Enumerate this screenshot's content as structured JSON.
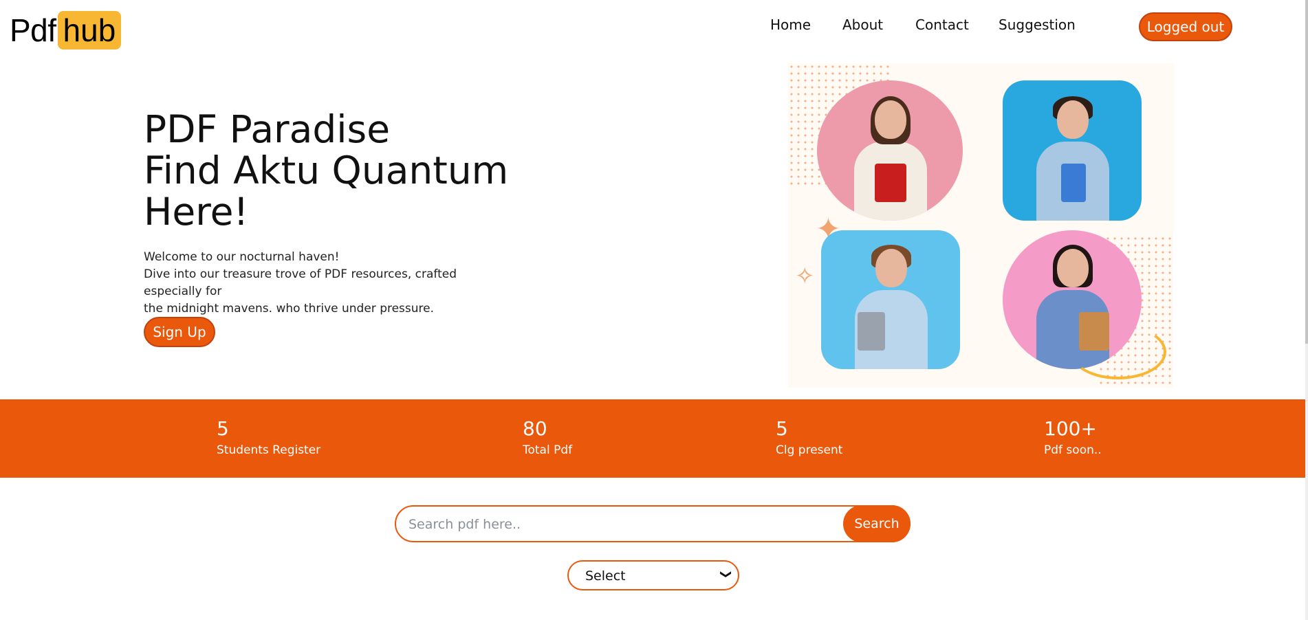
{
  "logo": {
    "part1": "Pdf",
    "part2": "hub",
    "accent": "#f7b733"
  },
  "nav": {
    "items": [
      "Home",
      "About",
      "Contact",
      "Suggestion"
    ],
    "logout_label": "Logged out"
  },
  "hero": {
    "title_lines": [
      "PDF Paradise",
      "Find Aktu Quantum",
      "Here!"
    ],
    "desc_lines": [
      "Welcome to our nocturnal haven!",
      "Dive into our treasure trove of PDF resources, crafted especially for",
      "the midnight mavens. who thrive under pressure."
    ],
    "signup_label": "Sign Up",
    "image_alt": "students-collage"
  },
  "stats": [
    {
      "value": "5",
      "label": "Students Register"
    },
    {
      "value": "80",
      "label": "Total Pdf"
    },
    {
      "value": "5",
      "label": "Clg present"
    },
    {
      "value": "100+",
      "label": "Pdf soon.."
    }
  ],
  "search": {
    "placeholder": "Search pdf here..",
    "button_label": "Search",
    "select_value": "Select"
  },
  "colors": {
    "brand": "#ea580c",
    "logo_accent": "#f7b733"
  }
}
